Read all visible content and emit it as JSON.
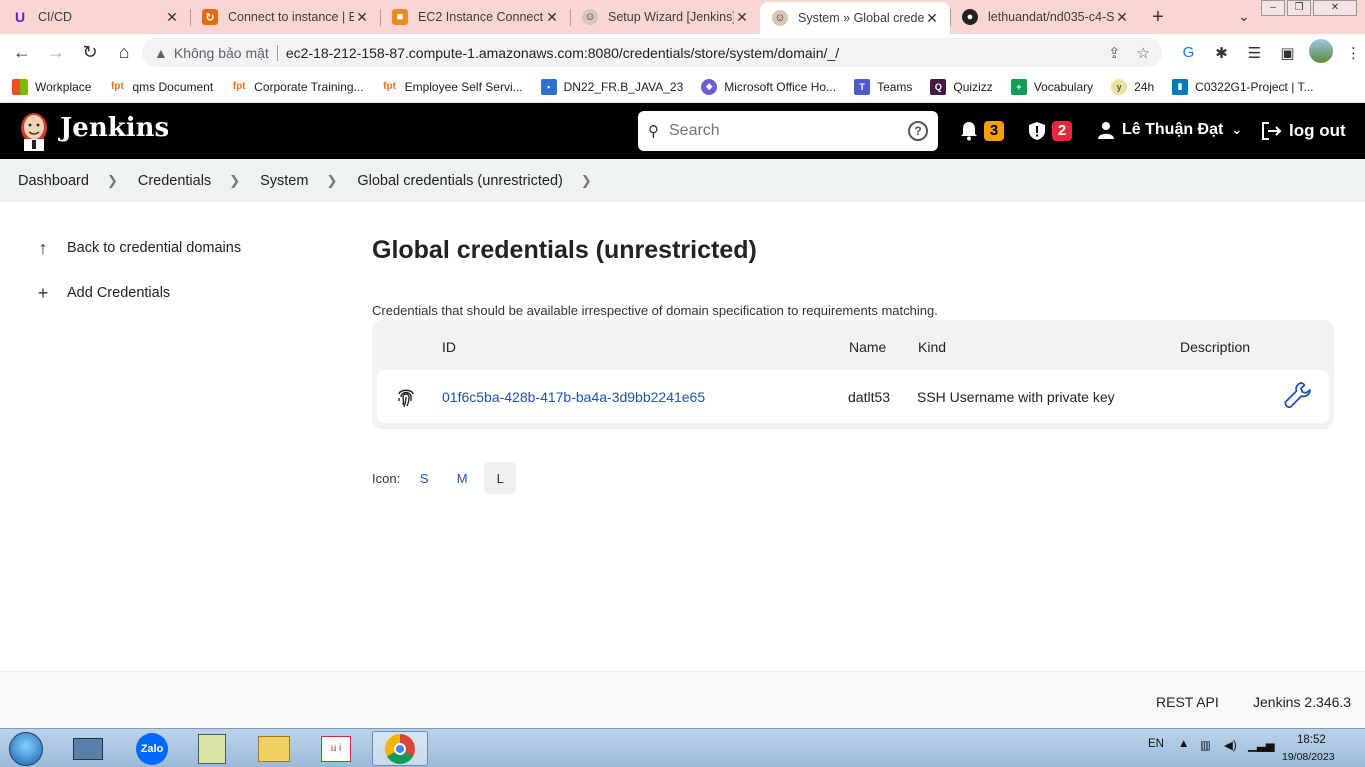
{
  "browser": {
    "tabs": [
      {
        "title": "CI/CD",
        "icon": "udemy-icon",
        "active": false
      },
      {
        "title": "Connect to instance | EC",
        "icon": "aws-orange-icon",
        "active": false
      },
      {
        "title": "EC2 Instance Connect",
        "icon": "aws-cube-icon",
        "active": false
      },
      {
        "title": "Setup Wizard [Jenkins]",
        "icon": "jenkins-icon",
        "active": false
      },
      {
        "title": "System » Global creden",
        "icon": "jenkins-icon",
        "active": true
      },
      {
        "title": "lethuandat/nd035-c4-S",
        "icon": "github-icon",
        "active": false
      }
    ],
    "insecure_label": "Không bảo mật",
    "url": "ec2-18-212-158-87.compute-1.amazonaws.com:8080/credentials/store/system/domain/_/",
    "bookmarks": [
      {
        "label": "Workplace",
        "icon": "windows-grid-icon"
      },
      {
        "label": "qms Document",
        "icon": "fpt-icon"
      },
      {
        "label": "Corporate Training...",
        "icon": "fpt-icon"
      },
      {
        "label": "Employee Self Servi...",
        "icon": "fpt-icon"
      },
      {
        "label": "DN22_FR.B_JAVA_23",
        "icon": "person-card-icon"
      },
      {
        "label": "Microsoft Office Ho...",
        "icon": "office-icon"
      },
      {
        "label": "Teams",
        "icon": "teams-icon"
      },
      {
        "label": "Quizizz",
        "icon": "quizizz-icon"
      },
      {
        "label": "Vocabulary",
        "icon": "sheets-icon"
      },
      {
        "label": "24h",
        "icon": "24h-icon"
      },
      {
        "label": "C0322G1-Project | T...",
        "icon": "trello-icon"
      }
    ]
  },
  "jenkins": {
    "brand": "Jenkins",
    "search_placeholder": "Search",
    "notifications_count": "3",
    "security_count": "2",
    "user_name": "Lê Thuận Đạt",
    "logout_label": "log out"
  },
  "breadcrumb": [
    "Dashboard",
    "Credentials",
    "System",
    "Global credentials (unrestricted)"
  ],
  "sidebar": [
    {
      "label": "Back to credential domains",
      "icon": "arrow-up-icon"
    },
    {
      "label": "Add Credentials",
      "icon": "plus-icon"
    }
  ],
  "main": {
    "title": "Global credentials (unrestricted)",
    "description": "Credentials that should be available irrespective of domain specification to requirements matching.",
    "columns": {
      "id": "ID",
      "name": "Name",
      "kind": "Kind",
      "description": "Description"
    },
    "rows": [
      {
        "id": "01f6c5ba-428b-417b-ba4a-3d9bb2241e65",
        "name": "datlt53",
        "kind": "SSH Username with private key",
        "description": ""
      }
    ],
    "icon_label": "Icon:",
    "icon_sizes": [
      "S",
      "M",
      "L"
    ],
    "icon_size_selected": "L"
  },
  "footer": {
    "rest_api": "REST API",
    "version": "Jenkins 2.346.3"
  },
  "taskbar": {
    "lang": "EN",
    "time": "18:52",
    "date": "19/08/2023"
  },
  "colors": {
    "jenkins_header": "#000000",
    "link_blue": "#1f52b5",
    "notif_badge": "#f59e0b",
    "security_badge": "#e5283d",
    "tab_strip": "#f9d6d2"
  }
}
